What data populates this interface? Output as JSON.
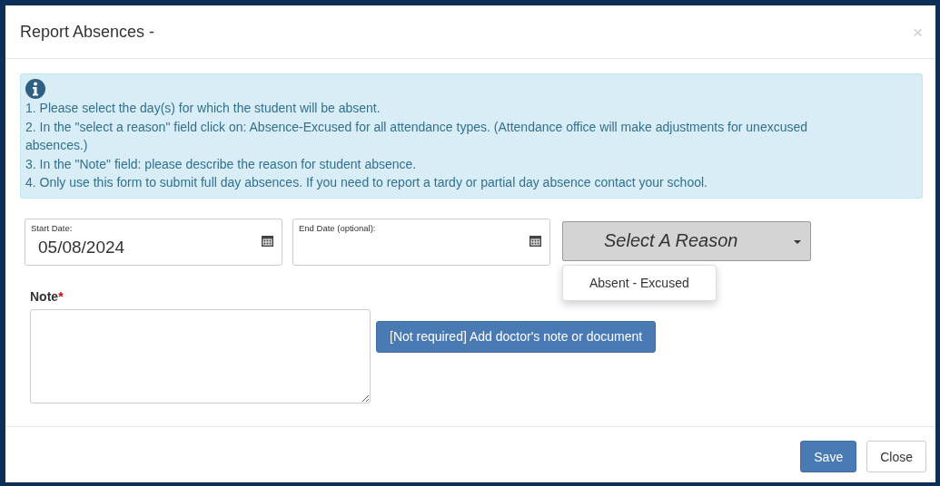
{
  "dialog": {
    "title": "Report Absences -",
    "close": "×"
  },
  "info": {
    "lines": [
      "1. Please select the day(s) for which the student will be absent.",
      "2. In the \"select a reason\" field click on: Absence-Excused for all attendance types. (Attendance office will make adjustments for unexcused absences.)",
      "3. In the \"Note\" field: please describe the reason for student absence.",
      "4. Only use this form to submit full day absences. If you need to report a tardy or partial day absence contact your school."
    ]
  },
  "fields": [
    {
      "label": "Start Date:",
      "value": "05/08/2024"
    },
    {
      "label": "End Date (optional):"
    }
  ],
  "reason": {
    "label": "Select A Reason",
    "expanded": true,
    "options": [
      "Absent - Excused"
    ]
  },
  "note": {
    "label": "Note",
    "required_mark": "*"
  },
  "upload_button": "[Not required] Add doctor's note or document",
  "buttons": [
    {
      "label": "Save",
      "kind": "primary"
    },
    {
      "label": "Close",
      "kind": "default"
    }
  ]
}
